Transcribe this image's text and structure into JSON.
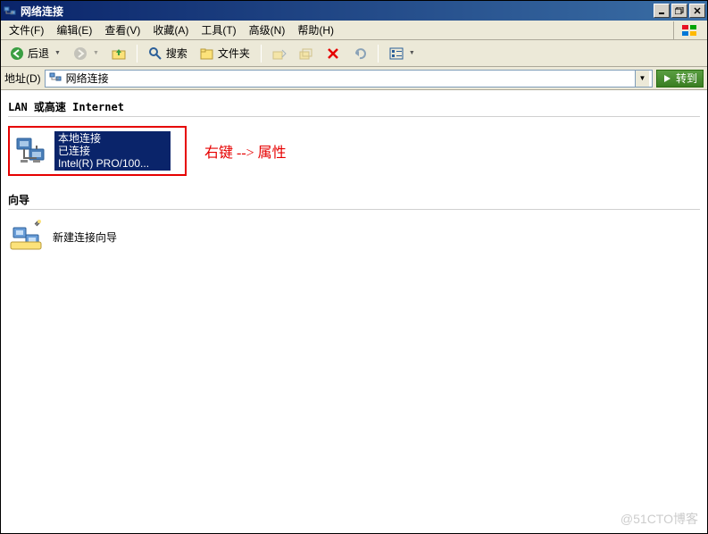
{
  "window": {
    "title": "网络连接",
    "minimize": "_",
    "restore": "❐",
    "close": "✕"
  },
  "menu": {
    "file": "文件(F)",
    "edit": "编辑(E)",
    "view": "查看(V)",
    "favorites": "收藏(A)",
    "tools": "工具(T)",
    "advanced": "高级(N)",
    "help": "帮助(H)"
  },
  "toolbar": {
    "back": "后退",
    "search": "搜索",
    "folders": "文件夹"
  },
  "addressbar": {
    "label": "地址(D)",
    "value": "网络连接",
    "go": "转到"
  },
  "groups": {
    "lan": "LAN 或高速 Internet",
    "wizard": "向导"
  },
  "connection": {
    "name": "本地连接",
    "status": "已连接",
    "device": "Intel(R) PRO/100..."
  },
  "annotation": "右键 --> 属性",
  "wizard_item": "新建连接向导",
  "watermark": "@51CTO博客"
}
